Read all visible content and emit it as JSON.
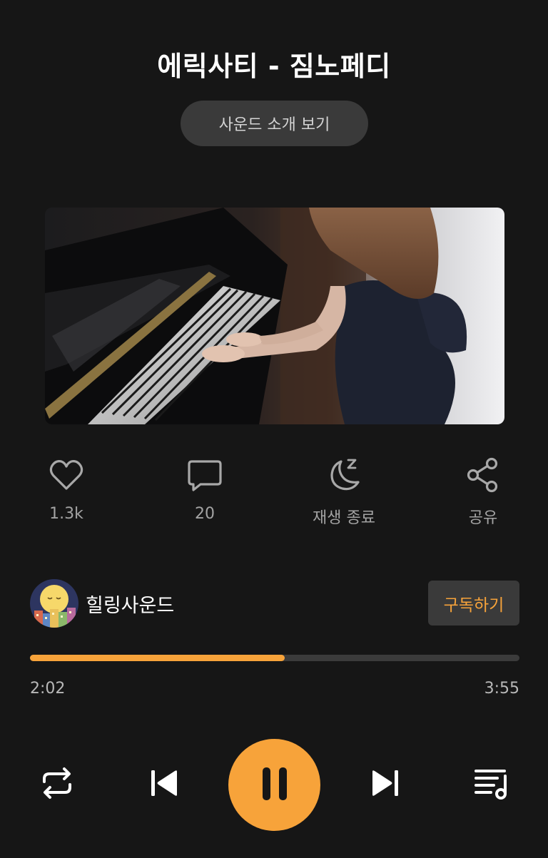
{
  "header": {
    "title": "에릭사티 - 짐노페디",
    "intro_button": "사운드 소개 보기"
  },
  "actions": [
    {
      "label": "1.3k",
      "icon": "heart-icon"
    },
    {
      "label": "20",
      "icon": "comment-icon"
    },
    {
      "label": "재생 종료",
      "icon": "sleep-timer-icon"
    },
    {
      "label": "공유",
      "icon": "share-icon"
    }
  ],
  "channel": {
    "name": "힐링사운드",
    "subscribe_label": "구독하기"
  },
  "player": {
    "elapsed": "2:02",
    "total": "3:55",
    "progress": 0.52
  },
  "colors": {
    "accent": "#f7a33a",
    "background": "#161616",
    "pill": "#3a3a3a",
    "muted_text": "#a3a3a3"
  }
}
